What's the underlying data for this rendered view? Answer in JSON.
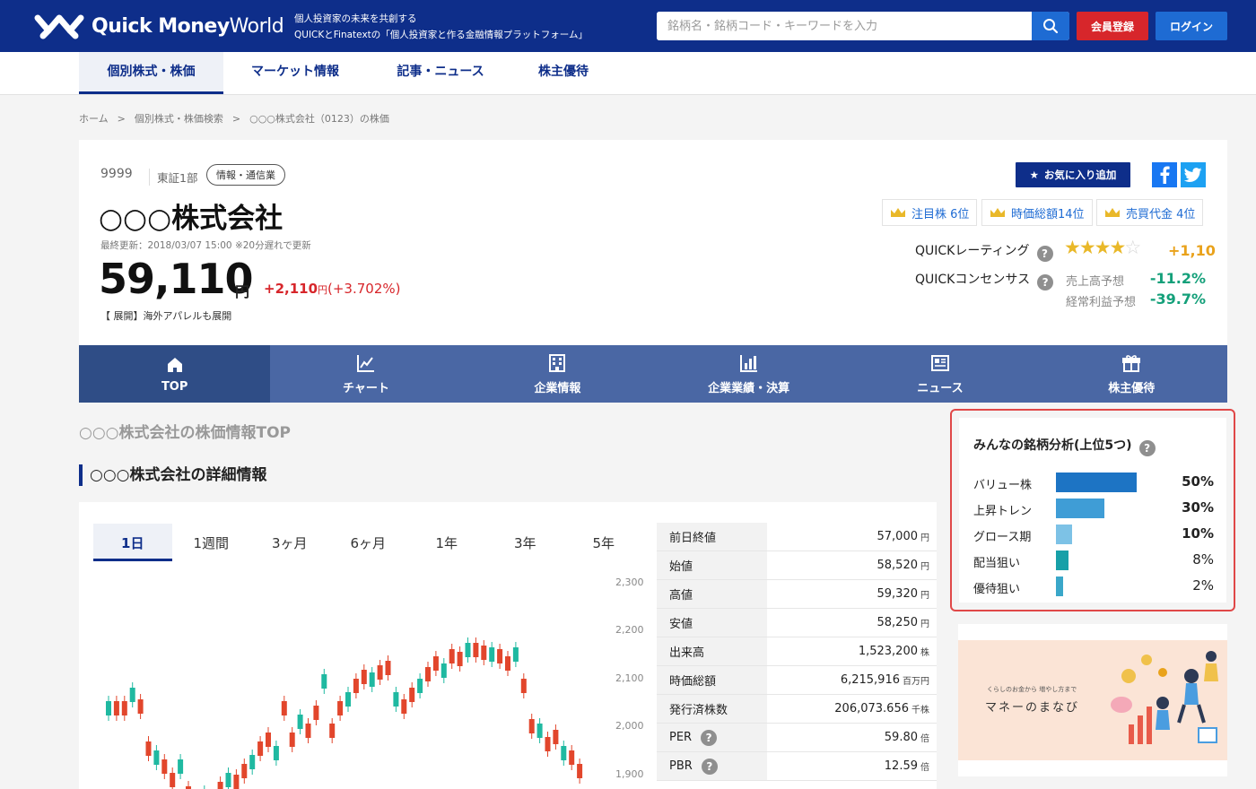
{
  "header": {
    "logo_bold": "Quick Money",
    "logo_light": "World",
    "tagline1": "個人投資家の未来を共創する",
    "tagline2": "QUICKとFinatextの「個人投資家と作る金融情報プラットフォーム」",
    "search_placeholder": "銘柄名・銘柄コード・キーワードを入力",
    "register_label": "会員登録",
    "login_label": "ログイン"
  },
  "nav": {
    "items": [
      {
        "label": "個別株式・株価"
      },
      {
        "label": "マーケット情報"
      },
      {
        "label": "記事・ニュース"
      },
      {
        "label": "株主優待"
      }
    ]
  },
  "breadcrumb": {
    "home": "ホーム",
    "sep": ">",
    "search": "個別株式・株価検索",
    "current": "○○○株式会社（0123）の株価"
  },
  "stock": {
    "code": "9999",
    "market": "東証1部",
    "sector": "情報・通信業",
    "name": "○○○株式会社",
    "updated": "最終更新：2018/03/07 15:00 ※20分遅れで更新",
    "price": "59,110",
    "price_unit": "円",
    "change": "+2,110",
    "change_unit": "円",
    "change_pct": "(+3.702%)",
    "note": "【 展開】海外アパレルも展開",
    "favorite_label": "お気に入り追加"
  },
  "rankings": [
    {
      "label": "注目株 6位"
    },
    {
      "label": "時価総額14位"
    },
    {
      "label": "売買代金 4位"
    }
  ],
  "rating": {
    "label": "QUICKレーティング",
    "stars_on": "★★★★",
    "stars_off": "☆",
    "value": "+1,10"
  },
  "consensus": {
    "label": "QUICKコンセンサス",
    "sales_label": "売上高予想",
    "sales_value": "-11.2%",
    "profit_label": "経常利益予想",
    "profit_value": "-39.7%"
  },
  "tabs": [
    {
      "label": "TOP",
      "icon": "home-icon"
    },
    {
      "label": "チャート",
      "icon": "chart-icon"
    },
    {
      "label": "企業情報",
      "icon": "building-icon"
    },
    {
      "label": "企業業績・決算",
      "icon": "bar-chart-icon"
    },
    {
      "label": "ニュース",
      "icon": "newspaper-icon"
    },
    {
      "label": "株主優待",
      "icon": "gift-icon"
    }
  ],
  "main": {
    "section_title": "○○○株式会社の株価情報TOP",
    "detail_title": "○○○株式会社の詳細情報",
    "ranges": [
      "1日",
      "1週間",
      "3ヶ月",
      "6ヶ月",
      "1年",
      "3年",
      "5年"
    ],
    "y_ticks": [
      "2,300",
      "2,200",
      "2,100",
      "2,000",
      "1,900"
    ]
  },
  "stats": [
    {
      "label": "前日終値",
      "value": "57,000",
      "unit": "円"
    },
    {
      "label": "始値",
      "value": "58,520",
      "unit": "円"
    },
    {
      "label": "高値",
      "value": "59,320",
      "unit": "円"
    },
    {
      "label": "安値",
      "value": "58,250",
      "unit": "円"
    },
    {
      "label": "出来高",
      "value": "1,523,200",
      "unit": "株"
    },
    {
      "label": "時価総額",
      "value": "6,215,916",
      "unit": "百万円"
    },
    {
      "label": "発行済株数",
      "value": "206,073.656",
      "unit": "千株"
    },
    {
      "label": "PER",
      "value": "59.80",
      "unit": "倍"
    },
    {
      "label": "PBR",
      "value": "12.59",
      "unit": "倍"
    }
  ],
  "analysis": {
    "title": "みんなの銘柄分析(上位5つ)",
    "items": [
      {
        "label": "バリュー株",
        "pct": "50%",
        "value": 50,
        "color": "#1d74c4"
      },
      {
        "label": "上昇トレン",
        "pct": "30%",
        "value": 30,
        "color": "#3f9dd6"
      },
      {
        "label": "グロース期",
        "pct": "10%",
        "value": 10,
        "color": "#7dc2e6"
      },
      {
        "label": "配当狙い",
        "pct": "8%",
        "value": 8,
        "color": "#17a0a8"
      },
      {
        "label": "優待狙い",
        "pct": "2%",
        "value": 2,
        "color": "#3aa7c9"
      }
    ]
  },
  "banner": {
    "small": "くらしのお金から 増やし方まで",
    "title": "マネーのまなび"
  }
}
